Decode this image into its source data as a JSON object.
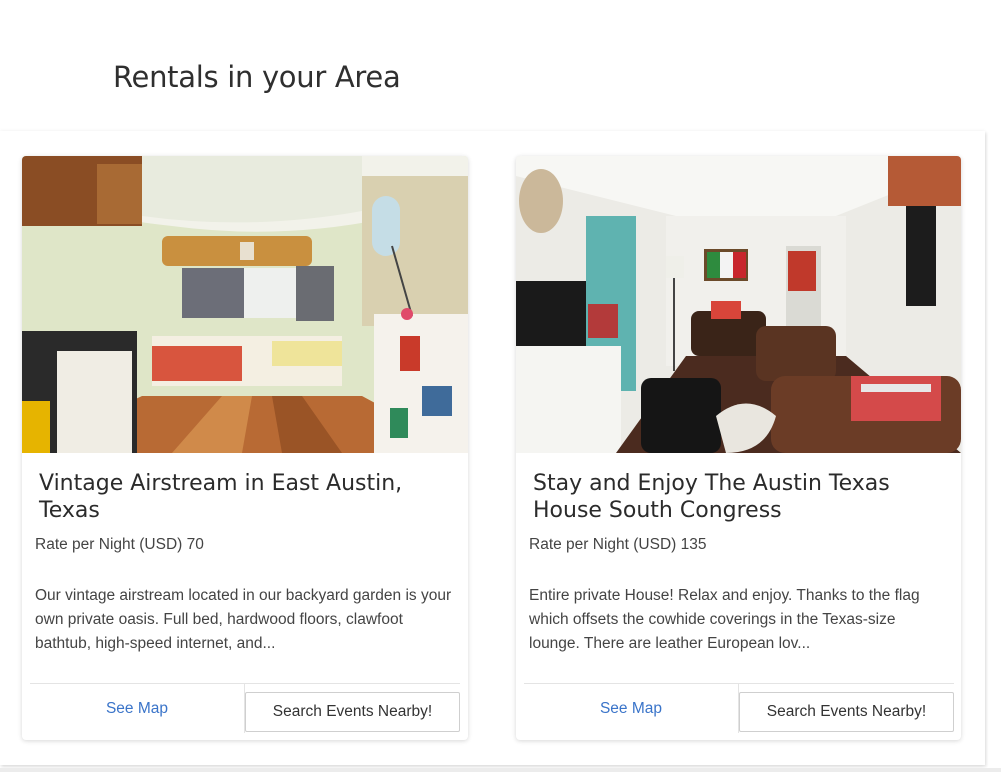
{
  "page": {
    "title": "Rentals in your Area"
  },
  "listings": [
    {
      "title": "Vintage Airstream in East Austin, Texas",
      "rate_label": "Rate per Night (USD)",
      "rate_value": "70",
      "description": "Our vintage airstream located in our backyard garden is your own private oasis. Full bed, hardwood floors, clawfoot bathtub, high-speed internet, and...",
      "map_link": "See Map",
      "events_button": "Search Events Nearby!",
      "photo_icon": "airstream-interior-photo"
    },
    {
      "title": "Stay and Enjoy The Austin Texas House South Congress",
      "rate_label": "Rate per Night (USD)",
      "rate_value": "135",
      "description": "Entire private House! Relax and enjoy. Thanks to the flag which offsets the cowhide coverings in the Texas-size lounge. There are leather European lov...",
      "map_link": "See Map",
      "events_button": "Search Events Nearby!",
      "photo_icon": "living-room-photo"
    }
  ],
  "colors": {
    "link": "#3a74c9",
    "text": "#333333",
    "border": "#e4e4e4"
  }
}
